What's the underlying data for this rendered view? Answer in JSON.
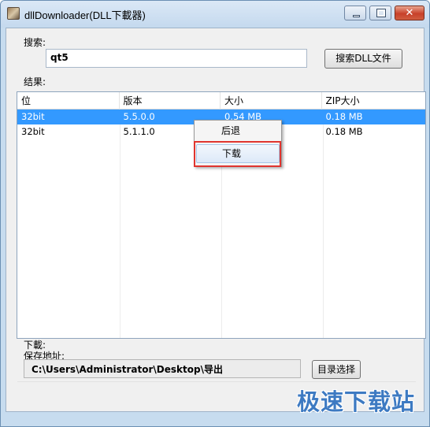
{
  "window": {
    "title": "dllDownloader(DLL下載器)",
    "close_glyph": "✕"
  },
  "search": {
    "label": "搜索:",
    "value": "qt5",
    "button_label": "搜索DLL文件"
  },
  "results": {
    "label": "结果:",
    "columns": [
      "位",
      "版本",
      "大小",
      "ZIP大小"
    ],
    "rows": [
      {
        "bits": "32bit",
        "version": "5.5.0.0",
        "size": "0.54 MB",
        "zip_size": "0.18 MB",
        "selected": true
      },
      {
        "bits": "32bit",
        "version": "5.1.1.0",
        "size": "",
        "zip_size": "0.18 MB",
        "selected": false
      }
    ]
  },
  "context_menu": {
    "items": [
      "后退",
      "下载"
    ],
    "highlighted": "下载"
  },
  "download": {
    "label": "下載:",
    "save_label": "保存地址:",
    "save_path": "C:\\Users\\Administrator\\Desktop\\导出",
    "browse_button": "目录选择"
  },
  "watermark": "极速下载站",
  "colors": {
    "selection": "#3399ff",
    "highlight_box": "#e0352f",
    "watermark": "#3d7ac2"
  }
}
